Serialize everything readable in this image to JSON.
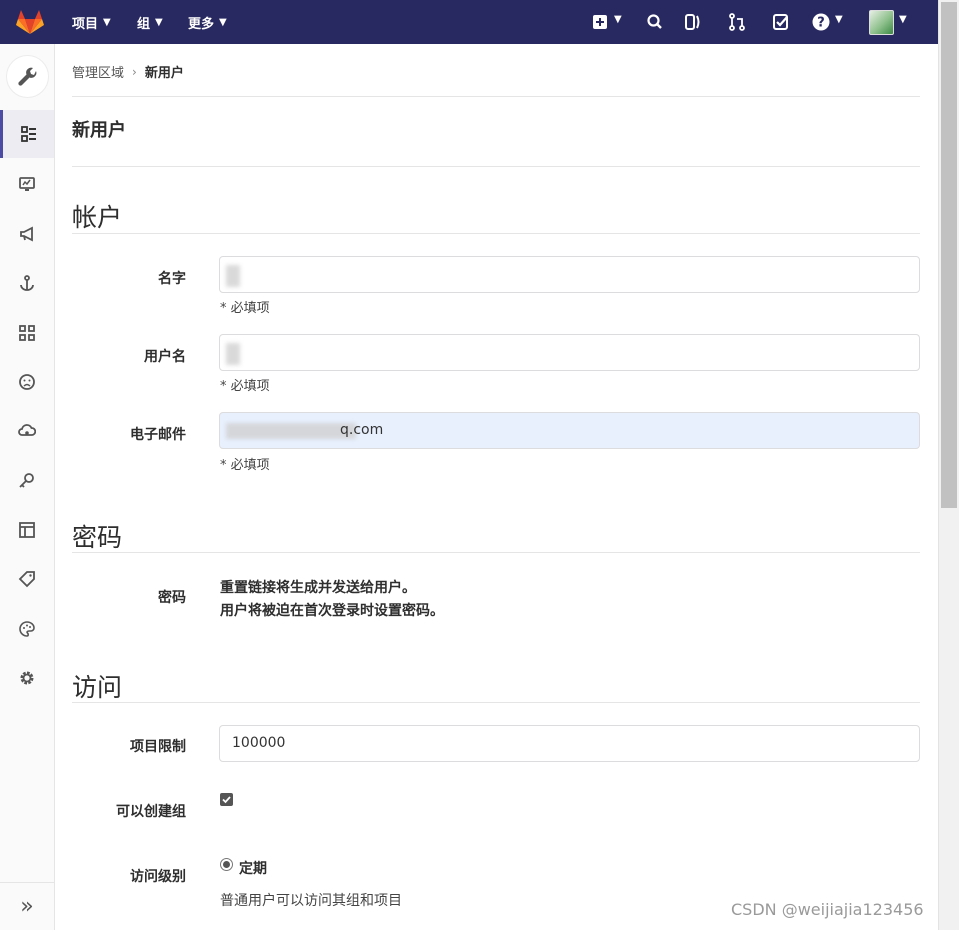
{
  "nav": {
    "projects": "项目",
    "groups": "组",
    "more": "更多"
  },
  "colors": {
    "topbar": "#292961",
    "sidebar_active": "#4b4ba3",
    "logo": "#e24329"
  },
  "breadcrumb": {
    "parent": "管理区域",
    "current": "新用户"
  },
  "page": {
    "title": "新用户"
  },
  "account": {
    "section_title": "帐户",
    "name_label": "名字",
    "username_label": "用户名",
    "email_label": "电子邮件",
    "email_value": "q.com",
    "required_hint": "* 必填项"
  },
  "password": {
    "section_title": "密码",
    "label": "密码",
    "note_line1": "重置链接将生成并发送给用户。",
    "note_line2": "用户将被迫在首次登录时设置密码。"
  },
  "access": {
    "section_title": "访问",
    "projects_limit_label": "项目限制",
    "projects_limit_value": "100000",
    "can_create_group_label": "可以创建组",
    "can_create_group_checked": true,
    "access_level_label": "访问级别",
    "access_level_option": "定期",
    "access_level_help": "普通用户可以访问其组和项目"
  },
  "watermark": "CSDN @weijiajia123456"
}
